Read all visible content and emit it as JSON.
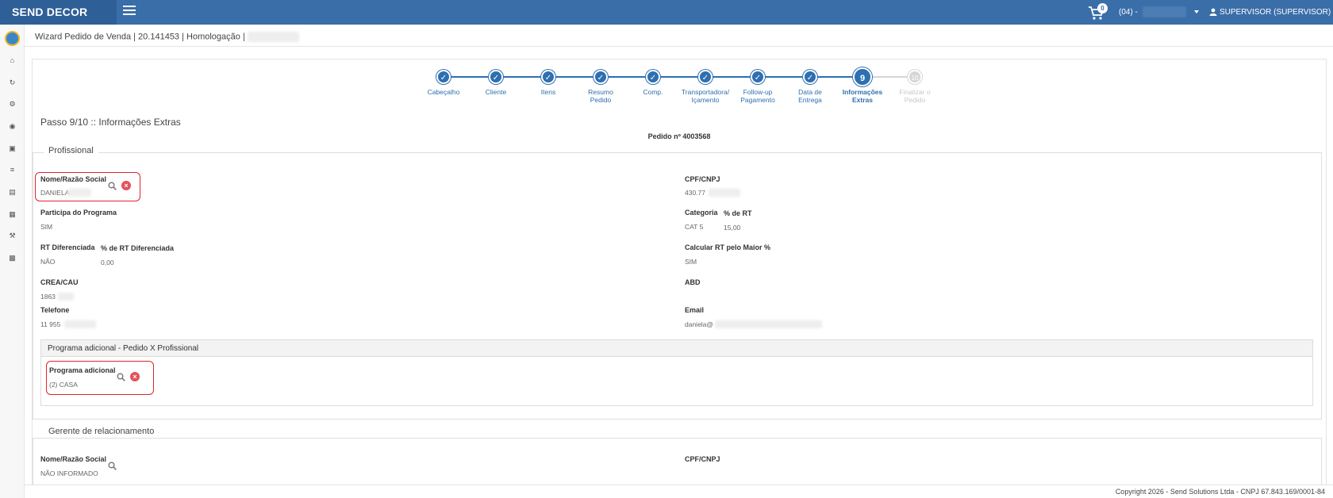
{
  "app": {
    "brand": "SEND DECOR"
  },
  "topbar": {
    "cart_count": "0",
    "store_label": "(04) -",
    "user_label": "SUPERVISOR (SUPERVISOR)"
  },
  "title": {
    "text": "Wizard Pedido de Venda | 20.141453 | Homologação |"
  },
  "steps": [
    {
      "label": "Cabeçalho",
      "state": "done"
    },
    {
      "label": "Cliente",
      "state": "done"
    },
    {
      "label": "Itens",
      "state": "done"
    },
    {
      "label": "Resumo Pedido",
      "state": "done"
    },
    {
      "label": "Comp.",
      "state": "done"
    },
    {
      "label": "Transportadora/ Içamento",
      "state": "done"
    },
    {
      "label": "Follow-up Pagamento",
      "state": "done"
    },
    {
      "label": "Data de Entrega",
      "state": "done"
    },
    {
      "label": "Informações Extras",
      "state": "current",
      "number": "9"
    },
    {
      "label": "Finalizar o Pedido",
      "state": "future",
      "number": "10"
    }
  ],
  "step_title": "Passo 9/10 :: Informações Extras",
  "order_number": "Pedido nº 4003568",
  "profissional": {
    "legend": "Profissional",
    "nome_label": "Nome/Razão Social",
    "nome_value": "DANIELA",
    "cpf_label": "CPF/CNPJ",
    "cpf_value": "430.77",
    "participa_label": "Participa do Programa",
    "participa_value": "SIM",
    "categoria_label": "Categoria",
    "categoria_value": "CAT 5",
    "rt_label": "% de RT",
    "rt_value": "15,00",
    "rt_dif_label": "RT Diferenciada",
    "rt_dif_value": "NÃO",
    "rt_dif_pct_label": "% de RT Diferenciada",
    "rt_dif_pct_value": "0,00",
    "calc_label": "Calcular RT pelo Maior %",
    "calc_value": "SIM",
    "crea_label": "CREA/CAU",
    "crea_value": "1863",
    "abd_label": "ABD",
    "telefone_label": "Telefone",
    "telefone_value": "11 955",
    "email_label": "Email",
    "email_value": "daniela@",
    "programa_box_title": "Programa adicional - Pedido X Profissional",
    "programa_label": "Programa adicional",
    "programa_value": "(2) CASA"
  },
  "gerente": {
    "legend": "Gerente de relacionamento",
    "nome_label": "Nome/Razão Social",
    "nome_value": "NÃO INFORMADO",
    "cpf_label": "CPF/CNPJ"
  },
  "footer": "Copyright 2026 - Send Solutions Ltda - CNPJ 67.843.169/0001-84"
}
